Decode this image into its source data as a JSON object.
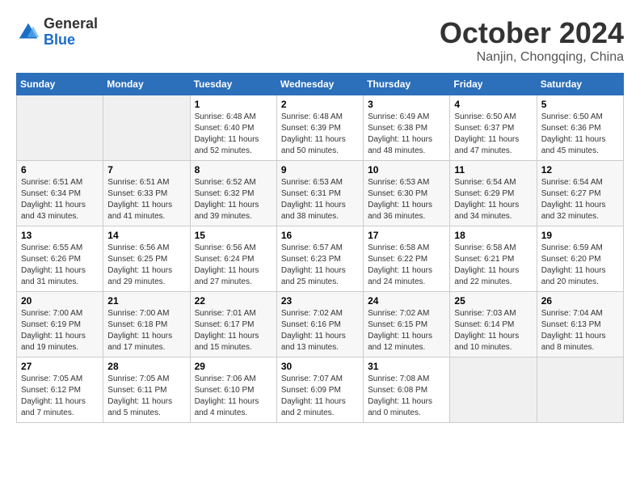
{
  "logo": {
    "line1": "General",
    "line2": "Blue"
  },
  "title": "October 2024",
  "subtitle": "Nanjin, Chongqing, China",
  "weekdays": [
    "Sunday",
    "Monday",
    "Tuesday",
    "Wednesday",
    "Thursday",
    "Friday",
    "Saturday"
  ],
  "weeks": [
    [
      {
        "day": null
      },
      {
        "day": null
      },
      {
        "day": "1",
        "sunrise": "Sunrise: 6:48 AM",
        "sunset": "Sunset: 6:40 PM",
        "daylight": "Daylight: 11 hours and 52 minutes."
      },
      {
        "day": "2",
        "sunrise": "Sunrise: 6:48 AM",
        "sunset": "Sunset: 6:39 PM",
        "daylight": "Daylight: 11 hours and 50 minutes."
      },
      {
        "day": "3",
        "sunrise": "Sunrise: 6:49 AM",
        "sunset": "Sunset: 6:38 PM",
        "daylight": "Daylight: 11 hours and 48 minutes."
      },
      {
        "day": "4",
        "sunrise": "Sunrise: 6:50 AM",
        "sunset": "Sunset: 6:37 PM",
        "daylight": "Daylight: 11 hours and 47 minutes."
      },
      {
        "day": "5",
        "sunrise": "Sunrise: 6:50 AM",
        "sunset": "Sunset: 6:36 PM",
        "daylight": "Daylight: 11 hours and 45 minutes."
      }
    ],
    [
      {
        "day": "6",
        "sunrise": "Sunrise: 6:51 AM",
        "sunset": "Sunset: 6:34 PM",
        "daylight": "Daylight: 11 hours and 43 minutes."
      },
      {
        "day": "7",
        "sunrise": "Sunrise: 6:51 AM",
        "sunset": "Sunset: 6:33 PM",
        "daylight": "Daylight: 11 hours and 41 minutes."
      },
      {
        "day": "8",
        "sunrise": "Sunrise: 6:52 AM",
        "sunset": "Sunset: 6:32 PM",
        "daylight": "Daylight: 11 hours and 39 minutes."
      },
      {
        "day": "9",
        "sunrise": "Sunrise: 6:53 AM",
        "sunset": "Sunset: 6:31 PM",
        "daylight": "Daylight: 11 hours and 38 minutes."
      },
      {
        "day": "10",
        "sunrise": "Sunrise: 6:53 AM",
        "sunset": "Sunset: 6:30 PM",
        "daylight": "Daylight: 11 hours and 36 minutes."
      },
      {
        "day": "11",
        "sunrise": "Sunrise: 6:54 AM",
        "sunset": "Sunset: 6:29 PM",
        "daylight": "Daylight: 11 hours and 34 minutes."
      },
      {
        "day": "12",
        "sunrise": "Sunrise: 6:54 AM",
        "sunset": "Sunset: 6:27 PM",
        "daylight": "Daylight: 11 hours and 32 minutes."
      }
    ],
    [
      {
        "day": "13",
        "sunrise": "Sunrise: 6:55 AM",
        "sunset": "Sunset: 6:26 PM",
        "daylight": "Daylight: 11 hours and 31 minutes."
      },
      {
        "day": "14",
        "sunrise": "Sunrise: 6:56 AM",
        "sunset": "Sunset: 6:25 PM",
        "daylight": "Daylight: 11 hours and 29 minutes."
      },
      {
        "day": "15",
        "sunrise": "Sunrise: 6:56 AM",
        "sunset": "Sunset: 6:24 PM",
        "daylight": "Daylight: 11 hours and 27 minutes."
      },
      {
        "day": "16",
        "sunrise": "Sunrise: 6:57 AM",
        "sunset": "Sunset: 6:23 PM",
        "daylight": "Daylight: 11 hours and 25 minutes."
      },
      {
        "day": "17",
        "sunrise": "Sunrise: 6:58 AM",
        "sunset": "Sunset: 6:22 PM",
        "daylight": "Daylight: 11 hours and 24 minutes."
      },
      {
        "day": "18",
        "sunrise": "Sunrise: 6:58 AM",
        "sunset": "Sunset: 6:21 PM",
        "daylight": "Daylight: 11 hours and 22 minutes."
      },
      {
        "day": "19",
        "sunrise": "Sunrise: 6:59 AM",
        "sunset": "Sunset: 6:20 PM",
        "daylight": "Daylight: 11 hours and 20 minutes."
      }
    ],
    [
      {
        "day": "20",
        "sunrise": "Sunrise: 7:00 AM",
        "sunset": "Sunset: 6:19 PM",
        "daylight": "Daylight: 11 hours and 19 minutes."
      },
      {
        "day": "21",
        "sunrise": "Sunrise: 7:00 AM",
        "sunset": "Sunset: 6:18 PM",
        "daylight": "Daylight: 11 hours and 17 minutes."
      },
      {
        "day": "22",
        "sunrise": "Sunrise: 7:01 AM",
        "sunset": "Sunset: 6:17 PM",
        "daylight": "Daylight: 11 hours and 15 minutes."
      },
      {
        "day": "23",
        "sunrise": "Sunrise: 7:02 AM",
        "sunset": "Sunset: 6:16 PM",
        "daylight": "Daylight: 11 hours and 13 minutes."
      },
      {
        "day": "24",
        "sunrise": "Sunrise: 7:02 AM",
        "sunset": "Sunset: 6:15 PM",
        "daylight": "Daylight: 11 hours and 12 minutes."
      },
      {
        "day": "25",
        "sunrise": "Sunrise: 7:03 AM",
        "sunset": "Sunset: 6:14 PM",
        "daylight": "Daylight: 11 hours and 10 minutes."
      },
      {
        "day": "26",
        "sunrise": "Sunrise: 7:04 AM",
        "sunset": "Sunset: 6:13 PM",
        "daylight": "Daylight: 11 hours and 8 minutes."
      }
    ],
    [
      {
        "day": "27",
        "sunrise": "Sunrise: 7:05 AM",
        "sunset": "Sunset: 6:12 PM",
        "daylight": "Daylight: 11 hours and 7 minutes."
      },
      {
        "day": "28",
        "sunrise": "Sunrise: 7:05 AM",
        "sunset": "Sunset: 6:11 PM",
        "daylight": "Daylight: 11 hours and 5 minutes."
      },
      {
        "day": "29",
        "sunrise": "Sunrise: 7:06 AM",
        "sunset": "Sunset: 6:10 PM",
        "daylight": "Daylight: 11 hours and 4 minutes."
      },
      {
        "day": "30",
        "sunrise": "Sunrise: 7:07 AM",
        "sunset": "Sunset: 6:09 PM",
        "daylight": "Daylight: 11 hours and 2 minutes."
      },
      {
        "day": "31",
        "sunrise": "Sunrise: 7:08 AM",
        "sunset": "Sunset: 6:08 PM",
        "daylight": "Daylight: 11 hours and 0 minutes."
      },
      {
        "day": null
      },
      {
        "day": null
      }
    ]
  ]
}
